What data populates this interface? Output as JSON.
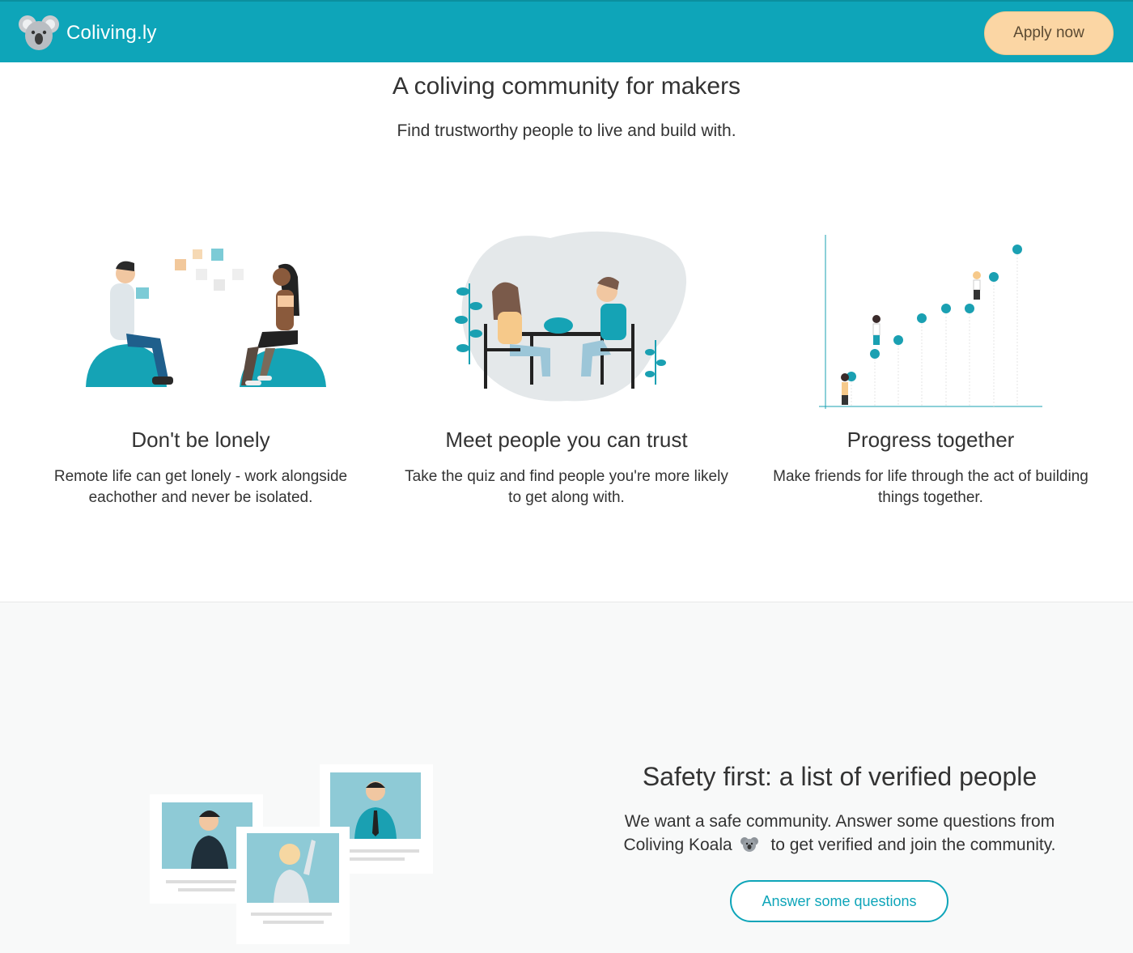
{
  "header": {
    "brand": "Coliving.ly",
    "apply_label": "Apply now"
  },
  "hero": {
    "title": "A coliving community for makers",
    "subtitle": "Find trustworthy people to live and build with."
  },
  "features": [
    {
      "title": "Don't be lonely",
      "text": "Remote life can get lonely - work alongside eachother and never be isolated.",
      "icon": "two-people-on-beanbags-illustration"
    },
    {
      "title": "Meet people you can trust",
      "text": "Take the quiz and find people you're more likely to get along with.",
      "icon": "people-eating-together-illustration"
    },
    {
      "title": "Progress together",
      "text": "Make friends for life through the act of building things together.",
      "icon": "people-climbing-growth-chart-illustration"
    }
  ],
  "safety": {
    "title": "Safety first: a list of verified people",
    "text_before": "We want a safe community. Answer some questions from Coliving Koala",
    "text_after": "to get verified and join the community.",
    "button_label": "Answer some questions",
    "icon": "koala-emoji-icon"
  },
  "colors": {
    "brand": "#0ea5b9",
    "apply_button": "#fbd6a4",
    "section_bg": "#f8f9f9"
  }
}
